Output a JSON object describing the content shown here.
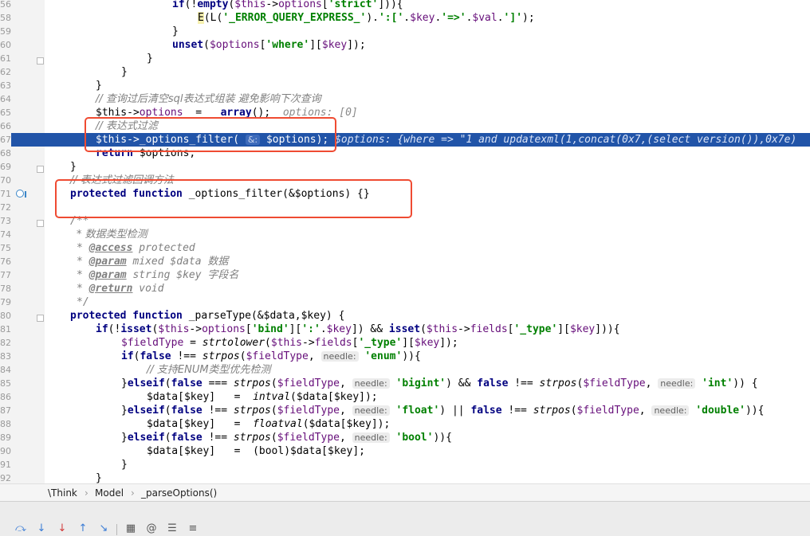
{
  "editor": {
    "lines": {
      "l56": {
        "no": "56"
      },
      "l58": {
        "no": "58"
      },
      "l59": {
        "no": "59"
      },
      "l60": {
        "no": "60"
      },
      "l61": {
        "no": "61"
      },
      "l62": {
        "no": "62"
      },
      "l63": {
        "no": "63"
      },
      "l64": {
        "no": "64",
        "comment": "// 查询过后清空sql表达式组装 避免影响下次查询"
      },
      "l65": {
        "no": "65",
        "inline_value": "options: [0]"
      },
      "l66": {
        "no": "66",
        "comment": "// 表达式过滤"
      },
      "l67": {
        "no": "67",
        "hint": "&:",
        "debug_value": "$options: {where => \"1 and updatexml(1,concat(0x7,(select version()),0x7e)"
      },
      "l68": {
        "no": "68"
      },
      "l69": {
        "no": "69"
      },
      "l70": {
        "no": "70",
        "comment": "// 表达式过滤回调方法"
      },
      "l71": {
        "no": "71"
      },
      "l72": {
        "no": "72"
      },
      "l73": {
        "no": "73"
      },
      "l74": {
        "no": "74",
        "text": "* 数据类型检测"
      },
      "l75": {
        "no": "75",
        "tag": "@access",
        "text": " protected"
      },
      "l76": {
        "no": "76",
        "tag": "@param",
        "text": " mixed $data 数据"
      },
      "l77": {
        "no": "77",
        "tag": "@param",
        "text": " string $key 字段名"
      },
      "l78": {
        "no": "78",
        "tag": "@return",
        "text": " void"
      },
      "l79": {
        "no": "79"
      },
      "l80": {
        "no": "80"
      },
      "l81": {
        "no": "81"
      },
      "l82": {
        "no": "82"
      },
      "l83": {
        "no": "83",
        "hint": "needle:"
      },
      "l84": {
        "no": "84",
        "comment": "// 支持ENUM类型优先检测"
      },
      "l85": {
        "no": "85",
        "hint1": "needle:",
        "hint2": "needle:"
      },
      "l86": {
        "no": "86"
      },
      "l87": {
        "no": "87",
        "hint1": "needle:",
        "hint2": "needle:"
      },
      "l88": {
        "no": "88"
      },
      "l89": {
        "no": "89",
        "hint": "needle:"
      },
      "l90": {
        "no": "90"
      },
      "l91": {
        "no": "91"
      },
      "l92": {
        "no": "92"
      }
    }
  },
  "breadcrumb": {
    "items": [
      "\\Think",
      "Model",
      "_parseOptions()"
    ],
    "separator": "›"
  },
  "colors": {
    "keyword": "#000080",
    "variable": "#660e7a",
    "string": "#008000",
    "comment": "#808080",
    "current_line": "#2154a8",
    "annotation_box": "#ef4b32"
  }
}
